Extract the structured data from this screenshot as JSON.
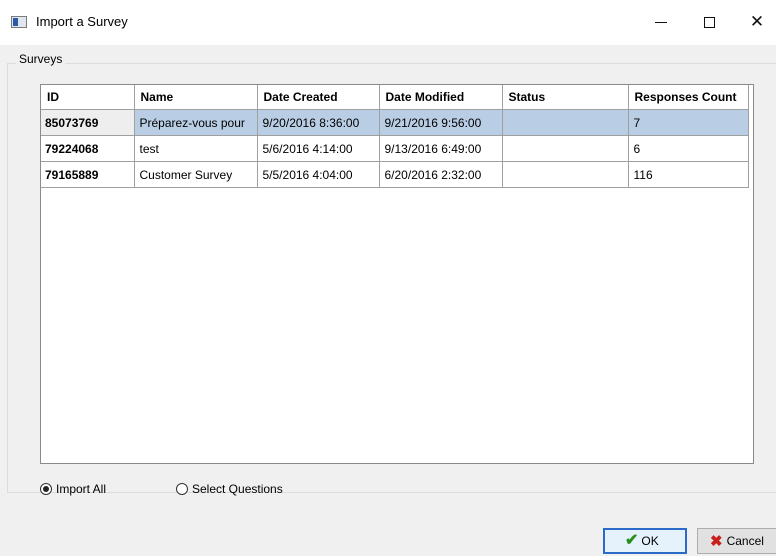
{
  "window": {
    "title": "Import a Survey",
    "icon": "app-window-icon"
  },
  "group": {
    "label": "Surveys"
  },
  "table": {
    "columns": [
      "ID",
      "Name",
      "Date Created",
      "Date Modified",
      "Status",
      "Responses Count"
    ],
    "rows": [
      {
        "id": "85073769",
        "name": "Préparez-vous pour",
        "created": "9/20/2016 8:36:00",
        "modified": "9/21/2016 9:56:00",
        "status": "",
        "responses": "7",
        "selected": true
      },
      {
        "id": "79224068",
        "name": "test",
        "created": "5/6/2016 4:14:00",
        "modified": "9/13/2016 6:49:00",
        "status": "",
        "responses": "6",
        "selected": false
      },
      {
        "id": "79165889",
        "name": "Customer Survey",
        "created": "5/5/2016 4:04:00",
        "modified": "6/20/2016 2:32:00",
        "status": "",
        "responses": "116",
        "selected": false
      }
    ]
  },
  "options": {
    "import_all": "Import All",
    "select_questions": "Select Questions",
    "selected": "import_all"
  },
  "buttons": {
    "ok": "OK",
    "cancel": "Cancel"
  },
  "colors": {
    "selection": "#b9cde4",
    "ok_border": "#2b6bc8",
    "check": "#2a8f1f",
    "cancel_x": "#c8211b"
  }
}
